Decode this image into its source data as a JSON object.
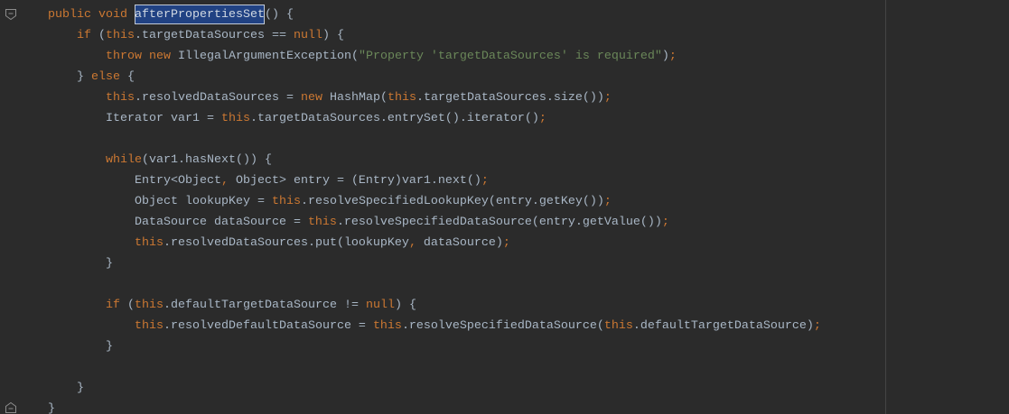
{
  "theme": {
    "background": "#2b2b2b",
    "text": "#a9b7c6",
    "keyword": "#cc7832",
    "string": "#6a8759",
    "punctuation": "#cc7832",
    "selection": "#214283",
    "selection_border": "#c3cbd6",
    "declaration": "#d0d8e2",
    "gutter_icon": "#8c8c8c",
    "right_margin": "#454545"
  },
  "editor": {
    "lines": [
      {
        "fold": {
          "type": "start",
          "icon": "fold-collapse-icon"
        },
        "tokens": [
          {
            "text": "public",
            "kind": "keyword"
          },
          {
            "text": " ",
            "kind": "plain"
          },
          {
            "text": "void",
            "kind": "keyword"
          },
          {
            "text": " ",
            "kind": "plain"
          },
          {
            "text": "afterPropertiesSet",
            "kind": "declaration"
          },
          {
            "text": "() {",
            "kind": "plain"
          }
        ]
      },
      {
        "tokens": [
          {
            "text": "    ",
            "kind": "plain"
          },
          {
            "text": "if",
            "kind": "keyword"
          },
          {
            "text": " (",
            "kind": "plain"
          },
          {
            "text": "this",
            "kind": "keyword"
          },
          {
            "text": ".targetDataSources == ",
            "kind": "plain"
          },
          {
            "text": "null",
            "kind": "keyword"
          },
          {
            "text": ") {",
            "kind": "plain"
          }
        ]
      },
      {
        "tokens": [
          {
            "text": "        ",
            "kind": "plain"
          },
          {
            "text": "throw",
            "kind": "keyword"
          },
          {
            "text": " ",
            "kind": "plain"
          },
          {
            "text": "new",
            "kind": "keyword"
          },
          {
            "text": " IllegalArgumentException(",
            "kind": "plain"
          },
          {
            "text": "\"Property 'targetDataSources' is required\"",
            "kind": "string"
          },
          {
            "text": ")",
            "kind": "plain"
          },
          {
            "text": ";",
            "kind": "punct"
          }
        ]
      },
      {
        "tokens": [
          {
            "text": "    } ",
            "kind": "plain"
          },
          {
            "text": "else",
            "kind": "keyword"
          },
          {
            "text": " {",
            "kind": "plain"
          }
        ]
      },
      {
        "tokens": [
          {
            "text": "        ",
            "kind": "plain"
          },
          {
            "text": "this",
            "kind": "keyword"
          },
          {
            "text": ".resolvedDataSources = ",
            "kind": "plain"
          },
          {
            "text": "new",
            "kind": "keyword"
          },
          {
            "text": " HashMap(",
            "kind": "plain"
          },
          {
            "text": "this",
            "kind": "keyword"
          },
          {
            "text": ".targetDataSources.size())",
            "kind": "plain"
          },
          {
            "text": ";",
            "kind": "punct"
          }
        ]
      },
      {
        "tokens": [
          {
            "text": "        Iterator var1 = ",
            "kind": "plain"
          },
          {
            "text": "this",
            "kind": "keyword"
          },
          {
            "text": ".targetDataSources.entrySet().iterator()",
            "kind": "plain"
          },
          {
            "text": ";",
            "kind": "punct"
          }
        ]
      },
      {
        "tokens": []
      },
      {
        "tokens": [
          {
            "text": "        ",
            "kind": "plain"
          },
          {
            "text": "while",
            "kind": "keyword"
          },
          {
            "text": "(var1.hasNext()) {",
            "kind": "plain"
          }
        ]
      },
      {
        "tokens": [
          {
            "text": "            Entry<Object",
            "kind": "plain"
          },
          {
            "text": ",",
            "kind": "punct"
          },
          {
            "text": " Object> entry = (Entry)var1.next()",
            "kind": "plain"
          },
          {
            "text": ";",
            "kind": "punct"
          }
        ]
      },
      {
        "tokens": [
          {
            "text": "            Object lookupKey = ",
            "kind": "plain"
          },
          {
            "text": "this",
            "kind": "keyword"
          },
          {
            "text": ".resolveSpecifiedLookupKey(entry.getKey())",
            "kind": "plain"
          },
          {
            "text": ";",
            "kind": "punct"
          }
        ]
      },
      {
        "tokens": [
          {
            "text": "            DataSource dataSource = ",
            "kind": "plain"
          },
          {
            "text": "this",
            "kind": "keyword"
          },
          {
            "text": ".resolveSpecifiedDataSource(entry.getValue())",
            "kind": "plain"
          },
          {
            "text": ";",
            "kind": "punct"
          }
        ]
      },
      {
        "tokens": [
          {
            "text": "            ",
            "kind": "plain"
          },
          {
            "text": "this",
            "kind": "keyword"
          },
          {
            "text": ".resolvedDataSources.put(lookupKey",
            "kind": "plain"
          },
          {
            "text": ",",
            "kind": "punct"
          },
          {
            "text": " dataSource)",
            "kind": "plain"
          },
          {
            "text": ";",
            "kind": "punct"
          }
        ]
      },
      {
        "tokens": [
          {
            "text": "        }",
            "kind": "plain"
          }
        ]
      },
      {
        "tokens": []
      },
      {
        "tokens": [
          {
            "text": "        ",
            "kind": "plain"
          },
          {
            "text": "if",
            "kind": "keyword"
          },
          {
            "text": " (",
            "kind": "plain"
          },
          {
            "text": "this",
            "kind": "keyword"
          },
          {
            "text": ".defaultTargetDataSource != ",
            "kind": "plain"
          },
          {
            "text": "null",
            "kind": "keyword"
          },
          {
            "text": ") {",
            "kind": "plain"
          }
        ]
      },
      {
        "tokens": [
          {
            "text": "            ",
            "kind": "plain"
          },
          {
            "text": "this",
            "kind": "keyword"
          },
          {
            "text": ".resolvedDefaultDataSource = ",
            "kind": "plain"
          },
          {
            "text": "this",
            "kind": "keyword"
          },
          {
            "text": ".resolveSpecifiedDataSource(",
            "kind": "plain"
          },
          {
            "text": "this",
            "kind": "keyword"
          },
          {
            "text": ".defaultTargetDataSource)",
            "kind": "plain"
          },
          {
            "text": ";",
            "kind": "punct"
          }
        ]
      },
      {
        "tokens": [
          {
            "text": "        }",
            "kind": "plain"
          }
        ]
      },
      {
        "tokens": []
      },
      {
        "tokens": [
          {
            "text": "    }",
            "kind": "plain"
          }
        ]
      },
      {
        "fold": {
          "type": "end",
          "icon": "fold-end-icon"
        },
        "tokens": [
          {
            "text": "}",
            "kind": "plain"
          }
        ]
      }
    ]
  }
}
